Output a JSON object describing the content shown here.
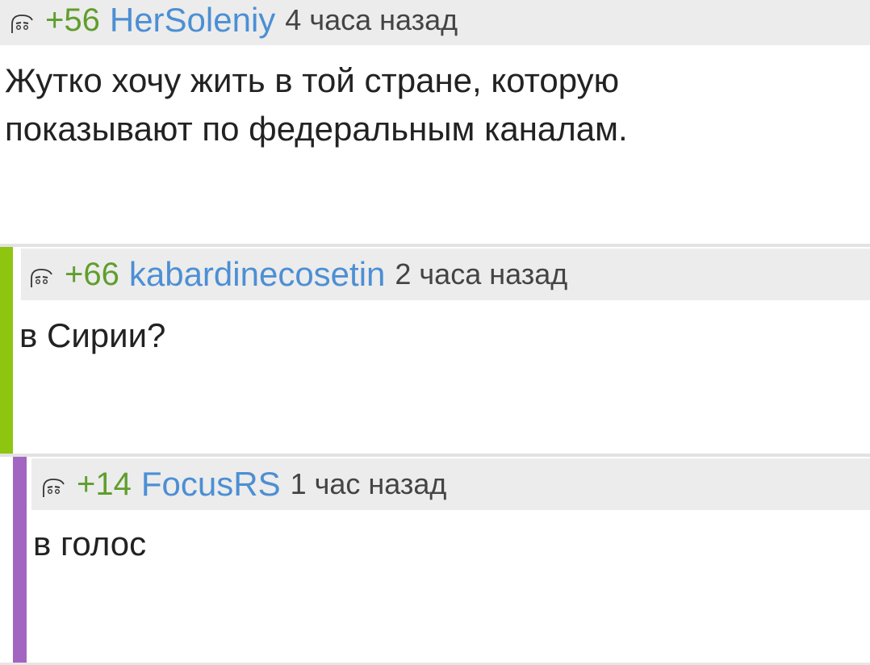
{
  "comments": [
    {
      "score": "+56",
      "username": "HerSoleniy",
      "time": "4 часа назад",
      "text_lines": [
        "Жутко хочу жить в той стране, которую",
        "показывают по федеральным каналам."
      ]
    },
    {
      "score": "+66",
      "username": "kabardinecosetin",
      "time": "2 часа назад",
      "text_lines": [
        "в Сирии?"
      ],
      "thread_color": "#8ec511"
    },
    {
      "score": "+14",
      "username": "FocusRS",
      "time": "1 час назад",
      "text_lines": [
        "в голос"
      ],
      "thread_color": "#a265c0"
    }
  ],
  "colors": {
    "score": "#5f9e2d",
    "username": "#4c8fd4",
    "header_bg": "#ececec"
  },
  "icons": {
    "avatar": "face-avatar-icon"
  }
}
